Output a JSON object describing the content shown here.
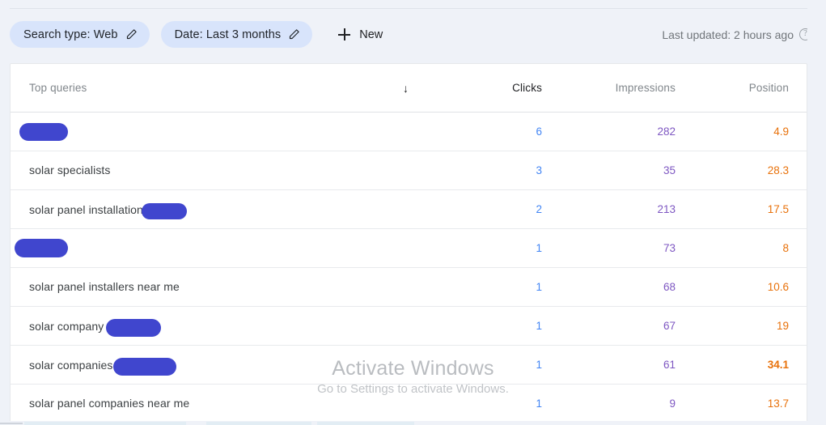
{
  "toolbar": {
    "filters": [
      {
        "label": "Search type: Web",
        "edit_icon": "pencil-icon"
      },
      {
        "label": "Date: Last 3 months",
        "edit_icon": "pencil-icon"
      }
    ],
    "new_button": {
      "label": "New",
      "icon": "plus-icon"
    },
    "last_updated": {
      "text": "Last updated: 2 hours ago",
      "help_icon": "help-circle-icon",
      "help_glyph": "?"
    }
  },
  "table": {
    "columns": {
      "query": "Top queries",
      "clicks": "Clicks",
      "impressions": "Impressions",
      "position": "Position"
    },
    "sort": {
      "column": "clicks",
      "direction": "desc",
      "arrow_glyph": "↓"
    },
    "rows": [
      {
        "query": "",
        "redacted": true,
        "clicks": "6",
        "impressions": "282",
        "position": "4.9"
      },
      {
        "query": "solar specialists",
        "redacted": false,
        "clicks": "3",
        "impressions": "35",
        "position": "28.3"
      },
      {
        "query": "solar panel installation",
        "redacted": true,
        "clicks": "2",
        "impressions": "213",
        "position": "17.5"
      },
      {
        "query": "",
        "redacted": true,
        "clicks": "1",
        "impressions": "73",
        "position": "8"
      },
      {
        "query": "solar panel installers near me",
        "redacted": false,
        "clicks": "1",
        "impressions": "68",
        "position": "10.6"
      },
      {
        "query": "solar company",
        "redacted": true,
        "clicks": "1",
        "impressions": "67",
        "position": "19"
      },
      {
        "query": "solar companies",
        "redacted": true,
        "clicks": "1",
        "impressions": "61",
        "position": "34.1"
      },
      {
        "query": "solar panel companies near me",
        "redacted": false,
        "clicks": "1",
        "impressions": "9",
        "position": "13.7"
      }
    ]
  },
  "watermark": {
    "title": "Activate Windows",
    "subtitle": "Go to Settings to activate Windows."
  },
  "colors": {
    "clicks": "#4285f4",
    "impressions": "#7e57c2",
    "position": "#e8710a",
    "chip_bg": "#d8e4fb",
    "redaction": "#4046ce",
    "page_bg": "#eff2f8"
  }
}
